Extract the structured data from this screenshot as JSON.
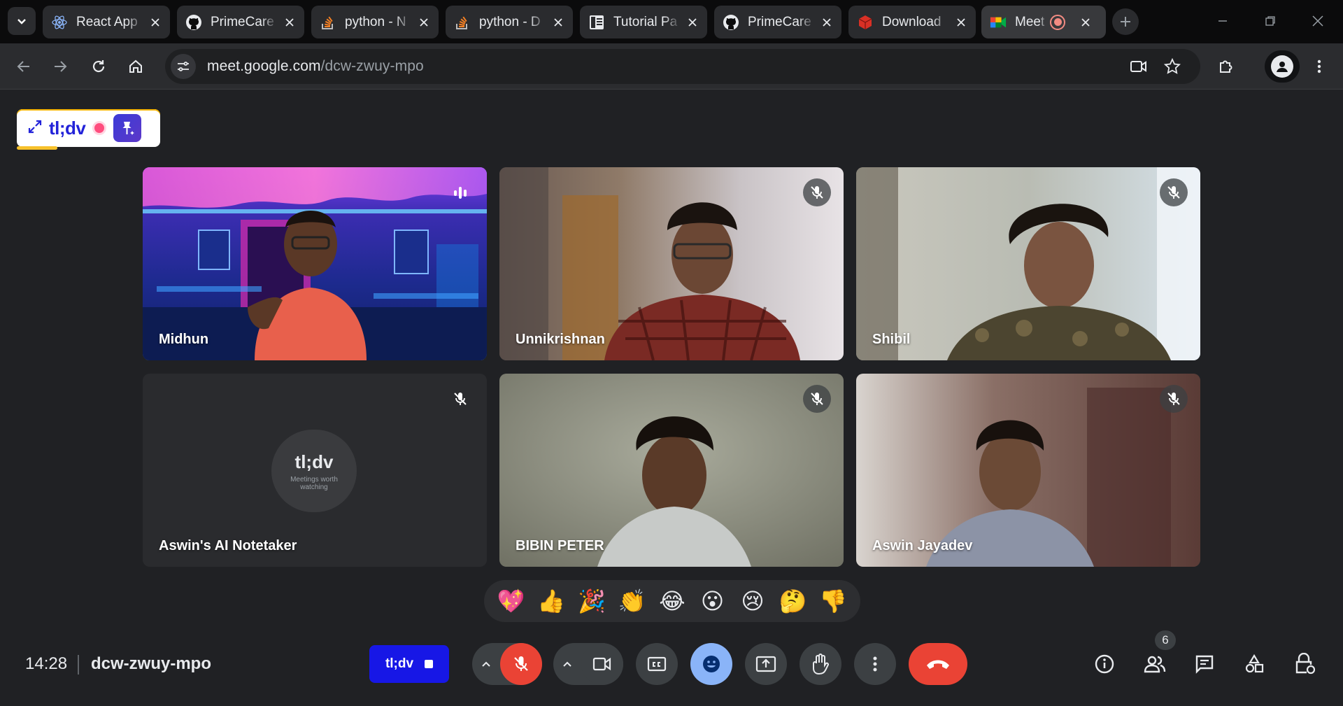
{
  "browser": {
    "tabs": [
      {
        "title": "React App",
        "icon": "react-icon"
      },
      {
        "title": "PrimeCare",
        "icon": "github-icon"
      },
      {
        "title": "python - N",
        "icon": "stackoverflow-icon"
      },
      {
        "title": "python - D",
        "icon": "stackoverflow-icon"
      },
      {
        "title": "Tutorial Pa",
        "icon": "tutorial-icon"
      },
      {
        "title": "PrimeCare",
        "icon": "github-icon"
      },
      {
        "title": "Download",
        "icon": "box-icon"
      },
      {
        "title": "Meet -",
        "icon": "google-meet-icon",
        "active": true,
        "recording": true
      }
    ],
    "url_host": "meet.google.com",
    "url_path": "/dcw-zwuy-mpo"
  },
  "tldv_badge": {
    "brand": "tl;dv"
  },
  "participants": [
    {
      "name": "Midhun",
      "speaking": true,
      "muted": false
    },
    {
      "name": "Unnikrishnan",
      "muted": true
    },
    {
      "name": "Shibil",
      "muted": true
    },
    {
      "name": "Aswin's AI Notetaker",
      "muted": true,
      "logo_title": "tl;dv",
      "logo_tagline": "Meetings worth watching"
    },
    {
      "name": "BIBIN PETER",
      "muted": true
    },
    {
      "name": "Aswin Jayadev",
      "muted": true
    }
  ],
  "reactions": [
    "💖",
    "👍",
    "🎉",
    "👏",
    "😂",
    "😮",
    "😢",
    "🤔",
    "👎"
  ],
  "bottom_bar": {
    "time": "14:28",
    "meeting_code": "dcw-zwuy-mpo",
    "tldv_button": "tl;dv",
    "people_count": "6"
  },
  "colors": {
    "meet_bg": "#202124",
    "active_outline": "#8ab4f8",
    "danger": "#ea4335",
    "tldv_blue": "#1717e6"
  }
}
